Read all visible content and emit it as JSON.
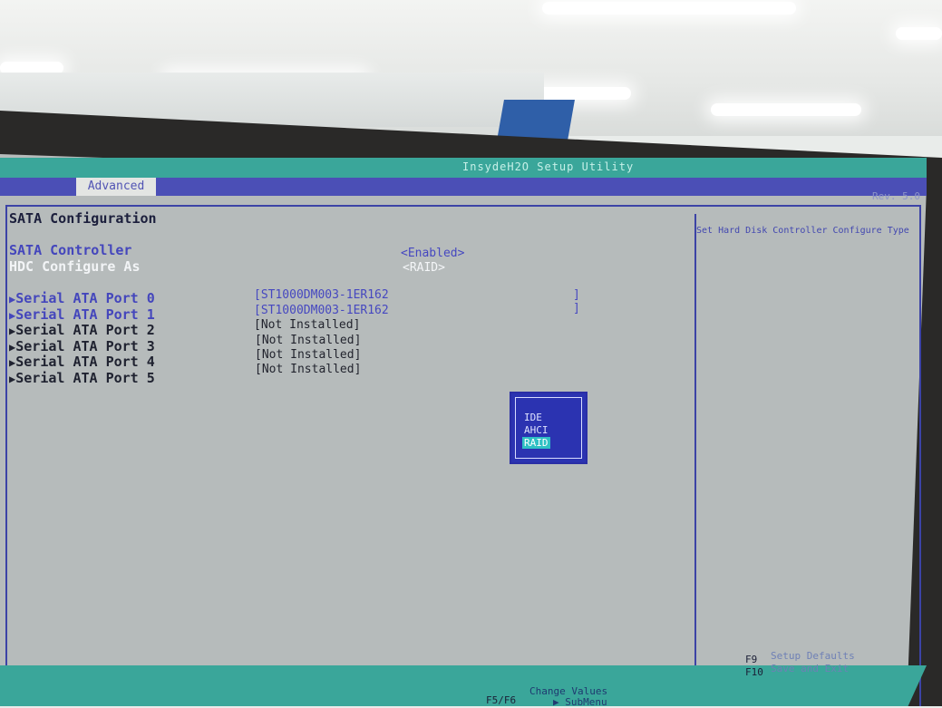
{
  "bios": {
    "utility_title": "InsydeH2O Setup Utility",
    "revision": "Rev. 5.0",
    "tabs": [
      {
        "label": "Advanced",
        "active": true
      }
    ],
    "page_title": "SATA Configuration",
    "settings": [
      {
        "label": "SATA Controller",
        "value": "<Enabled>"
      },
      {
        "label": "HDC Configure As",
        "value": "<RAID>"
      }
    ],
    "ports": [
      {
        "label": "Serial ATA Port 0",
        "value": "[ST1000DM003-1ER162",
        "close": "]"
      },
      {
        "label": "Serial ATA Port 1",
        "value": "[ST1000DM003-1ER162",
        "close": "]"
      },
      {
        "label": "Serial ATA Port 2",
        "value": "[Not Installed]"
      },
      {
        "label": "Serial ATA Port 3",
        "value": "[Not Installed]"
      },
      {
        "label": "Serial ATA Port 4",
        "value": "[Not Installed]"
      },
      {
        "label": "Serial ATA Port 5",
        "value": "[Not Installed]"
      }
    ],
    "help_text": "Set Hard Disk Controller Configure Type",
    "popup": {
      "options": [
        "IDE",
        "AHCI",
        "RAID"
      ],
      "selected": "RAID"
    },
    "footer": {
      "f9_key": "F9",
      "f9_label": "Setup Defaults",
      "f10_key": "F10",
      "f10_label": "Save and Exit",
      "f5f6_key": "F5/F6",
      "f5f6_label": "Change Values",
      "enter_label": "SubMenu"
    }
  },
  "colors": {
    "screen_bg": "#b6bbbb",
    "header_teal": "#3aa69a",
    "menu_blue": "#4b4fb6",
    "accent_text": "#4446bc",
    "popup_bg": "#2b33b1",
    "highlight": "#2fc0c4"
  }
}
